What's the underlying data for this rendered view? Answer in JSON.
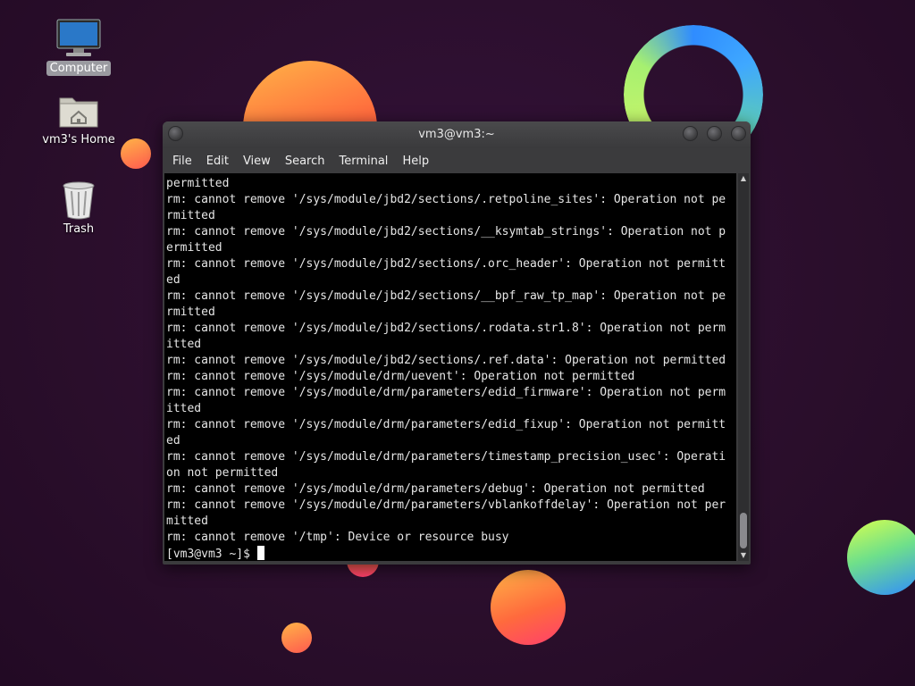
{
  "desktop": {
    "icons": [
      {
        "label": "Computer",
        "icon": "computer-icon",
        "selected": true
      },
      {
        "label": "vm3's Home",
        "icon": "home-folder-icon",
        "selected": false
      },
      {
        "label": "Trash",
        "icon": "trash-icon",
        "selected": false
      }
    ]
  },
  "window": {
    "title": "vm3@vm3:~",
    "menu": [
      "File",
      "Edit",
      "View",
      "Search",
      "Terminal",
      "Help"
    ]
  },
  "terminal": {
    "lines": [
      "permitted",
      "rm: cannot remove '/sys/module/jbd2/sections/.retpoline_sites': Operation not pe",
      "rmitted",
      "rm: cannot remove '/sys/module/jbd2/sections/__ksymtab_strings': Operation not p",
      "ermitted",
      "rm: cannot remove '/sys/module/jbd2/sections/.orc_header': Operation not permitt",
      "ed",
      "rm: cannot remove '/sys/module/jbd2/sections/__bpf_raw_tp_map': Operation not pe",
      "rmitted",
      "rm: cannot remove '/sys/module/jbd2/sections/.rodata.str1.8': Operation not perm",
      "itted",
      "rm: cannot remove '/sys/module/jbd2/sections/.ref.data': Operation not permitted",
      "rm: cannot remove '/sys/module/drm/uevent': Operation not permitted",
      "rm: cannot remove '/sys/module/drm/parameters/edid_firmware': Operation not perm",
      "itted",
      "rm: cannot remove '/sys/module/drm/parameters/edid_fixup': Operation not permitt",
      "ed",
      "rm: cannot remove '/sys/module/drm/parameters/timestamp_precision_usec': Operati",
      "on not permitted",
      "rm: cannot remove '/sys/module/drm/parameters/debug': Operation not permitted",
      "rm: cannot remove '/sys/module/drm/parameters/vblankoffdelay': Operation not per",
      "mitted",
      "rm: cannot remove '/tmp': Device or resource busy"
    ],
    "prompt": "[vm3@vm3 ~]$ "
  }
}
